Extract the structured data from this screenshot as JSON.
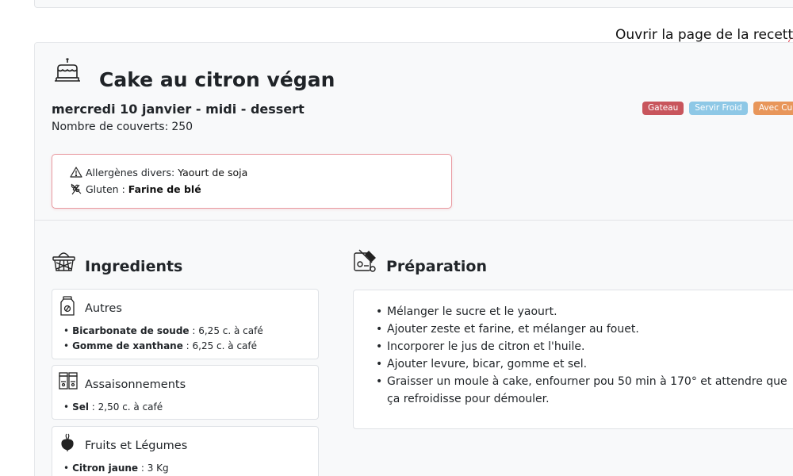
{
  "header": {
    "open_link": "Ouvrir la page de la recette"
  },
  "recipe": {
    "title": "Cake au citron végan",
    "subtitle": "mercredi 10 janvier - midi - dessert",
    "covers_label": "Nombre de couverts:",
    "covers_value": "250",
    "badges": [
      {
        "label": "Gateau",
        "color": "#c8555c"
      },
      {
        "label": "Servir Froid",
        "color": "#8ec8e6"
      },
      {
        "label": "Avec Cuisson",
        "color": "#e8965a"
      }
    ]
  },
  "allergens": [
    {
      "icon": "warning-icon",
      "label": "Allergènes divers:",
      "value": "Yaourt de soja"
    },
    {
      "icon": "wheat-icon",
      "label": "Gluten :",
      "value": "Farine de blé"
    }
  ],
  "ingredients": {
    "title": "Ingredients",
    "categories": [
      {
        "name": "Autres",
        "icon": "jar-icon",
        "items": [
          {
            "name": "Bicarbonate de soude",
            "qty": " : 6,25 c. à café"
          },
          {
            "name": "Gomme de xanthane",
            "qty": " : 6,25 c. à café"
          }
        ]
      },
      {
        "name": "Assaisonnements",
        "icon": "spice-jars-icon",
        "items": [
          {
            "name": "Sel",
            "qty": " : 2,50 c. à café"
          }
        ]
      },
      {
        "name": "Fruits et Légumes",
        "icon": "beet-icon",
        "items": [
          {
            "name": "Citron jaune",
            "qty": " : 3 Kg"
          }
        ]
      }
    ]
  },
  "preparation": {
    "title": "Préparation",
    "steps": [
      "Mélanger le sucre et le yaourt.",
      "Ajouter zeste et farine, et mélanger au fouet.",
      "Incorporer le jus de citron et l'huile.",
      "Ajouter levure, bicar, gomme et sel.",
      "Graisser un moule à cake, enfourner pou 50 min à 170° et attendre que ça refroidisse pour démouler."
    ]
  }
}
